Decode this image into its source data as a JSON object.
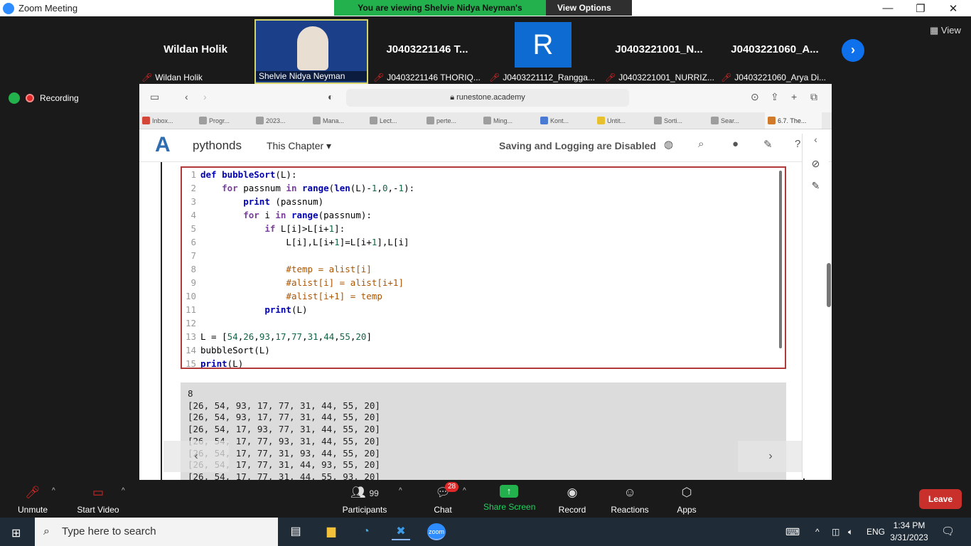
{
  "window": {
    "title": "Zoom Meeting",
    "banner": "You are viewing Shelvie Nidya Neyman's screen",
    "view_options": "View Options",
    "minimize": "—",
    "restore": "❐",
    "close": "✕"
  },
  "gallery": {
    "view_label": "View",
    "tiles": [
      {
        "big": "Wildan Holik",
        "name": "Wildan Holik"
      },
      {
        "big": "",
        "name": "Shelvie Nidya Neyman"
      },
      {
        "big": "J0403221146 T...",
        "name": "J0403221146 THORIQ..."
      },
      {
        "big": "R",
        "name": "J0403221112_Rangga..."
      },
      {
        "big": "J0403221001_N...",
        "name": "J0403221001_NURRIZ..."
      },
      {
        "big": "J0403221060_A...",
        "name": "J0403221060_Arya Di..."
      }
    ],
    "next_icon": "›"
  },
  "recording": {
    "label": "Recording"
  },
  "browser": {
    "url": "runestone.academy",
    "tabs": [
      "Inbox...",
      "Progr...",
      "2023...",
      "Mana...",
      "Lect...",
      "perte...",
      "Ming...",
      "Kont...",
      "Untit...",
      "Sorti...",
      "Sear...",
      "6.7. The..."
    ],
    "site": {
      "brand": "pythonds",
      "chapter": "This Chapter ▾",
      "saving": "Saving and Logging are Disabled"
    },
    "code": [
      {
        "n": "1",
        "t": "def bubbleSort(L):"
      },
      {
        "n": "2",
        "t": "    for passnum in range(len(L)-1,0,-1):"
      },
      {
        "n": "3",
        "t": "        print (passnum)"
      },
      {
        "n": "4",
        "t": "        for i in range(passnum):"
      },
      {
        "n": "5",
        "t": "            if L[i]>L[i+1]:"
      },
      {
        "n": "6",
        "t": "                L[i],L[i+1]=L[i+1],L[i]"
      },
      {
        "n": "7",
        "t": ""
      },
      {
        "n": "8",
        "t": "                #temp = alist[i]"
      },
      {
        "n": "9",
        "t": "                #alist[i] = alist[i+1]"
      },
      {
        "n": "10",
        "t": "                #alist[i+1] = temp"
      },
      {
        "n": "11",
        "t": "            print(L)"
      },
      {
        "n": "12",
        "t": ""
      },
      {
        "n": "13",
        "t": "L = [54,26,93,17,77,31,44,55,20]"
      },
      {
        "n": "14",
        "t": "bubbleSort(L)"
      },
      {
        "n": "15",
        "t": "print(L)"
      }
    ],
    "output": "8\n[26, 54, 93, 17, 77, 31, 44, 55, 20]\n[26, 54, 93, 17, 77, 31, 44, 55, 20]\n[26, 54, 17, 93, 77, 31, 44, 55, 20]\n[26, 54, 17, 77, 93, 31, 44, 55, 20]\n[26, 54, 17, 77, 31, 93, 44, 55, 20]\n[26, 54, 17, 77, 31, 44, 93, 55, 20]\n[26, 54, 17, 77, 31, 44, 55, 93, 20]",
    "prev": "‹",
    "next": "›"
  },
  "controls": {
    "unmute": "Unmute",
    "start_video": "Start Video",
    "participants": "Participants",
    "participants_count": "99",
    "chat": "Chat",
    "chat_badge": "28",
    "share": "Share Screen",
    "record": "Record",
    "reactions": "Reactions",
    "apps": "Apps",
    "leave": "Leave"
  },
  "taskbar": {
    "search_placeholder": "Type here to search",
    "lang": "ENG",
    "time": "1:34 PM",
    "date": "3/31/2023"
  }
}
